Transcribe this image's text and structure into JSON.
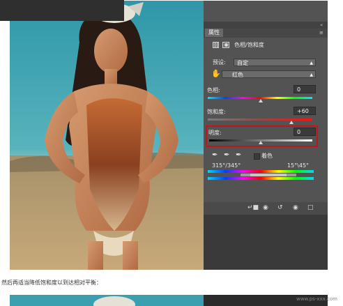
{
  "panel": {
    "tab_label": "属性",
    "title": "色相/饱和度",
    "preset_label": "预设:",
    "preset_value": "自定",
    "channel_value": "红色",
    "hue_label": "色相:",
    "hue_value": "0",
    "saturation_label": "饱和度:",
    "saturation_value": "+60",
    "lightness_label": "明度:",
    "lightness_value": "0",
    "colorize_label": "着色",
    "range_left": "315°/345°",
    "range_right": "15°\\45°"
  },
  "caption": "然后再适当降低饱和度以到达相对平衡：",
  "watermark": "www.ps-xxx.com",
  "icons": {
    "collapse": "double-chevron-icon",
    "menu": "panel-menu-icon",
    "adjustment": "adjustment-layer-icon",
    "mask": "mask-icon",
    "hand": "targeted-adjust-icon",
    "eyedroppers": [
      "eyedropper-icon",
      "eyedropper-plus-icon",
      "eyedropper-minus-icon"
    ],
    "bottom": [
      "clip-to-layer-icon",
      "view-previous-icon",
      "reset-icon",
      "visibility-icon",
      "trash-icon"
    ]
  },
  "colors": {
    "highlight_border": "#c0151d",
    "panel_bg": "#535353",
    "field_bg": "#3a3a3a"
  }
}
